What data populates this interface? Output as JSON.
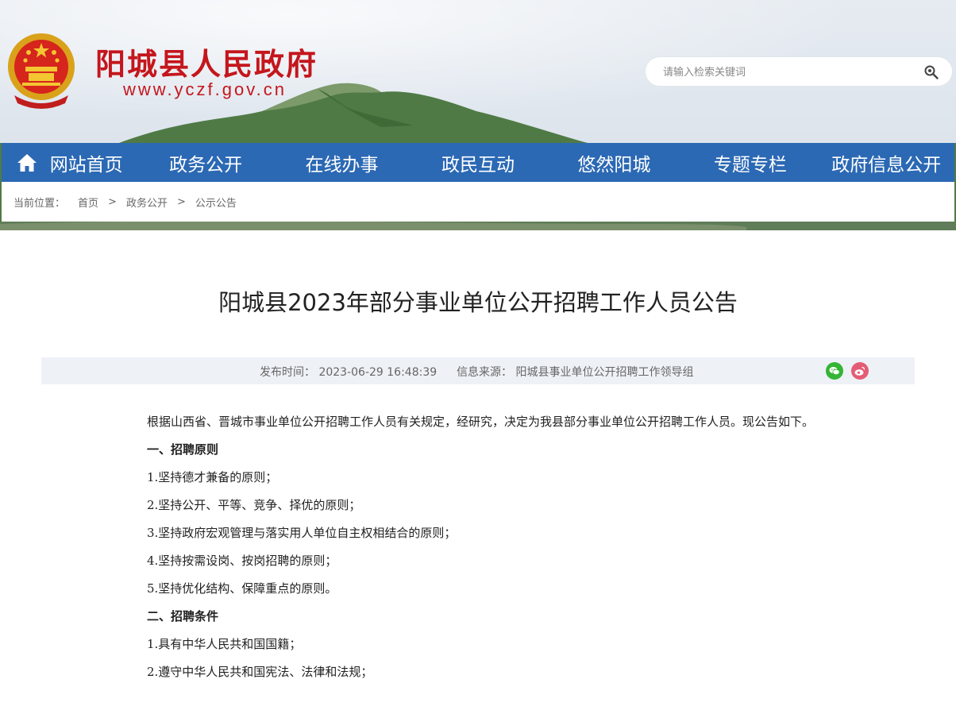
{
  "header": {
    "site_title": "阳城县人民政府",
    "site_url": "www.yczf.gov.cn",
    "search_placeholder": "请输入检索关键词"
  },
  "nav": {
    "items": [
      {
        "label": "网站首页",
        "icon": "home-icon"
      },
      {
        "label": "政务公开"
      },
      {
        "label": "在线办事"
      },
      {
        "label": "政民互动"
      },
      {
        "label": "悠然阳城"
      },
      {
        "label": "专题专栏"
      },
      {
        "label": "政府信息公开"
      }
    ]
  },
  "breadcrumb": {
    "label": "当前位置：",
    "items": [
      "首页",
      "政务公开",
      "公示公告"
    ],
    "separator": ">"
  },
  "article": {
    "title": "阳城县2023年部分事业单位公开招聘工作人员公告",
    "meta": {
      "published_label": "发布时间：",
      "published_value": "2023-06-29 16:48:39",
      "source_label": "信息来源：",
      "source_value": "阳城县事业单位公开招聘工作领导组"
    },
    "share": [
      "wechat-icon",
      "weibo-icon"
    ],
    "intro": "根据山西省、晋城市事业单位公开招聘工作人员有关规定，经研究，决定为我县部分事业单位公开招聘工作人员。现公告如下。",
    "section1_heading": "一、招聘原则",
    "section1_items": [
      "1.坚持德才兼备的原则；",
      "2.坚持公开、平等、竞争、择优的原则；",
      "3.坚持政府宏观管理与落实用人单位自主权相结合的原则；",
      "4.坚持按需设岗、按岗招聘的原则；",
      "5.坚持优化结构、保障重点的原则。"
    ],
    "section2_heading": "二、招聘条件",
    "section2_items": [
      "1.具有中华人民共和国国籍；",
      "2.遵守中华人民共和国宪法、法律和法规；"
    ]
  },
  "colors": {
    "nav_bg": "#2c69b4",
    "title_red": "#c4161c",
    "meta_bg": "#eef1f6",
    "wechat_green": "#35b435",
    "weibo_pink": "#e35d74"
  }
}
